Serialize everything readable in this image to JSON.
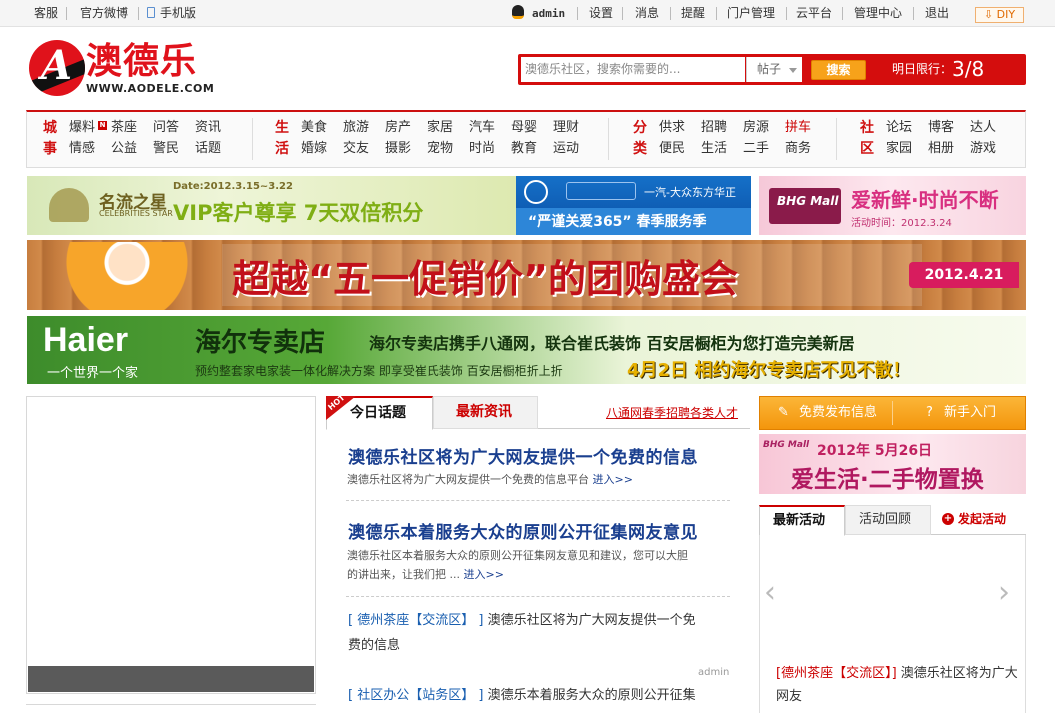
{
  "topbar": {
    "left_links": [
      "客服",
      "官方微博",
      "手机版"
    ],
    "user": "admin",
    "right_links": [
      "设置",
      "消息",
      "提醒",
      "门户管理",
      "云平台",
      "管理中心",
      "退出"
    ],
    "diy": "DIY"
  },
  "logo": {
    "name": "澳德乐",
    "url": "WWW.AODELE.COM",
    "mark": "A"
  },
  "search": {
    "placeholder": "澳德乐社区，搜索你需要的...",
    "type": "帖子",
    "button": "搜索",
    "limit_label": "明日限行：",
    "limit_value": "3/8"
  },
  "nav": {
    "groups": [
      {
        "title": [
          "城",
          "事"
        ],
        "links": [
          "爆料",
          "茶座",
          "问答",
          "资讯",
          "情感",
          "公益",
          "警民",
          "话题"
        ]
      },
      {
        "title": [
          "生",
          "活"
        ],
        "links": [
          "美食",
          "旅游",
          "房产",
          "家居",
          "汽车",
          "母婴",
          "理财",
          "婚嫁",
          "交友",
          "摄影",
          "宠物",
          "时尚",
          "教育",
          "运动"
        ]
      },
      {
        "title": [
          "分",
          "类"
        ],
        "links": [
          "供求",
          "招聘",
          "房源",
          "拼车",
          "便民",
          "生活",
          "二手",
          "商务"
        ]
      },
      {
        "title": [
          "社",
          "区"
        ],
        "links": [
          "论坛",
          "博客",
          "达人",
          "家园",
          "相册",
          "游戏"
        ]
      }
    ],
    "new_badge": "N"
  },
  "banners": {
    "b1": {
      "brand": "名流之星",
      "brand_en": "CELEBRITIES STAR",
      "date": "Date:2012.3.15~3.22",
      "text": "VIP客户尊享 7天双倍积分"
    },
    "b2": {
      "brand": "一汽-大众东方华正",
      "text": "“严谨关爱365” 春季服务季"
    },
    "b3": {
      "brand": "BHG Mall",
      "text": "爱新鲜·时尚不断",
      "date": "活动时间：2012.3.24"
    },
    "b4": {
      "text": "超越“五一促销价”的团购盛会",
      "date": "2012.4.21"
    },
    "b5": {
      "brand": "Haier",
      "slogan": "一个世界一个家",
      "shop": "海尔专卖店",
      "line1": "海尔专卖店携手八通网，联合崔氏装饰 百安居橱柜为您打造完美新居",
      "line2": "预约整套家电家装一体化解决方案 即享受崔氏装饰 百安居橱柜折上折",
      "line3": "4月2日 相约海尔专卖店不见不散！"
    }
  },
  "middle": {
    "hot": "HOT",
    "tabs": [
      "今日话题",
      "最新资讯"
    ],
    "recruit_link": "八通网春季招聘各类人才",
    "headlines": [
      {
        "title": "澳德乐社区将为广大网友提供一个免费的信息",
        "summary": [
          "澳德乐社区将为广大网友提供一个免费的信息平台"
        ],
        "more": "进入>>"
      },
      {
        "title": "澳德乐本着服务大众的原则公开征集网友意见",
        "summary": [
          "澳德乐社区本着服务大众的原则公开征集网友意见和建议，您可以大胆",
          "的讲出来，让我们把 ..."
        ],
        "more": "进入>>"
      }
    ],
    "links": [
      {
        "tag": "[ 德州茶座【交流区】 ]",
        "text": "澳德乐社区将为广大网友提供一个免",
        "text2": "费的信息"
      },
      {
        "tag": "[ 社区办公【站务区】 ]",
        "text": "澳德乐本着服务大众的原则公开征集"
      }
    ],
    "author": "admin"
  },
  "side": {
    "btn_publish": "免费发布信息",
    "btn_help": "新手入门",
    "banner": {
      "brand": "BHG Mall",
      "date": "2012年 5月26日",
      "text": "爱生活·二手物置换"
    },
    "tabs": [
      "最新活动",
      "活动回顾"
    ],
    "start": "发起活动",
    "prev": "‹",
    "next": "›",
    "item_tag": "[德州茶座【交流区】]",
    "item_text": "澳德乐社区将为广大网友"
  }
}
